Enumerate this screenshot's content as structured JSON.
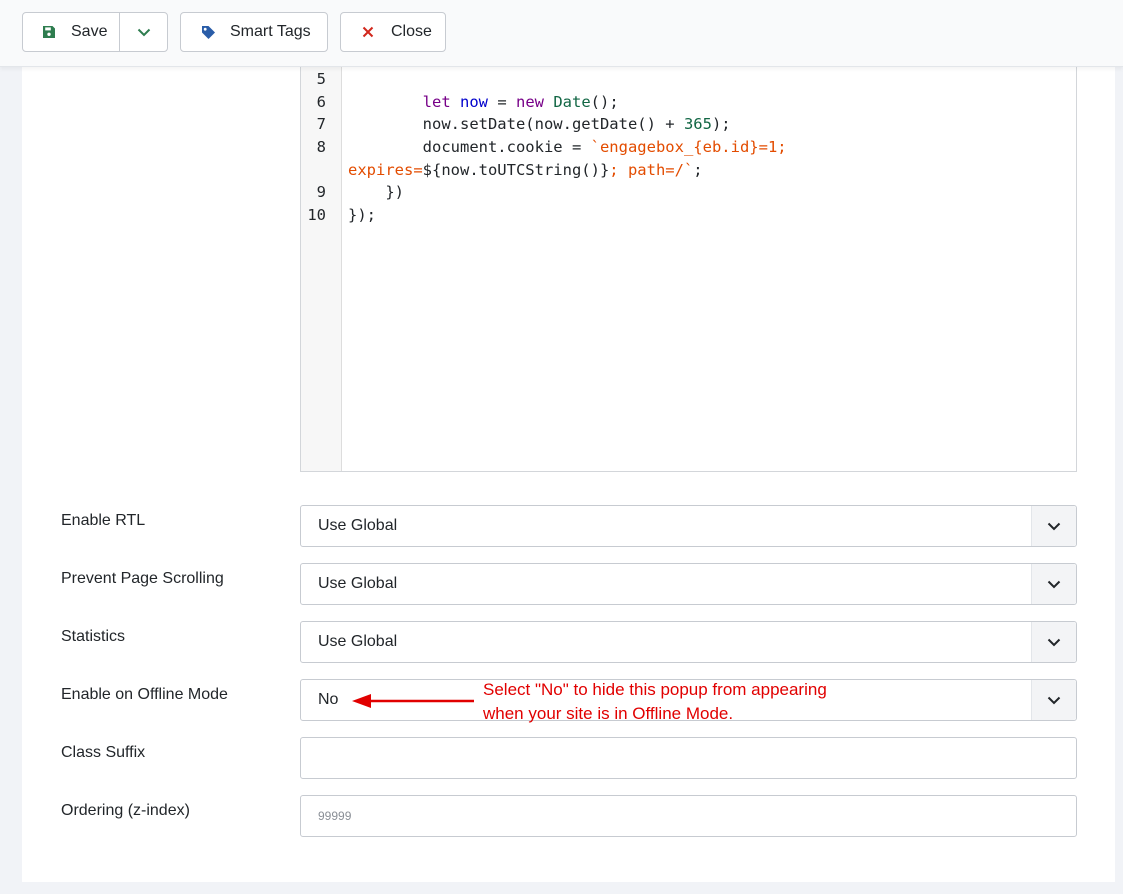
{
  "toolbar": {
    "save_label": "Save",
    "smart_tags_label": "Smart Tags",
    "close_label": "Close"
  },
  "editor": {
    "lines": [
      {
        "num": "5",
        "segments": []
      },
      {
        "num": "6",
        "segments": [
          {
            "t": "        ",
            "c": ""
          },
          {
            "t": "let",
            "c": "kw"
          },
          {
            "t": " ",
            "c": ""
          },
          {
            "t": "now",
            "c": "var"
          },
          {
            "t": " = ",
            "c": ""
          },
          {
            "t": "new",
            "c": "kw"
          },
          {
            "t": " ",
            "c": ""
          },
          {
            "t": "Date",
            "c": "def"
          },
          {
            "t": "();",
            "c": ""
          }
        ]
      },
      {
        "num": "7",
        "segments": [
          {
            "t": "        now.setDate(now.getDate() + ",
            "c": ""
          },
          {
            "t": "365",
            "c": "def"
          },
          {
            "t": ");",
            "c": ""
          }
        ]
      },
      {
        "num": "8",
        "segments": [
          {
            "t": "        document.cookie = ",
            "c": ""
          },
          {
            "t": "`engagebox_{eb.id}=1;",
            "c": "str"
          }
        ]
      },
      {
        "num": "",
        "segments": [
          {
            "t": "expires=",
            "c": "str"
          },
          {
            "t": "${now.toUTCString()}",
            "c": ""
          },
          {
            "t": "; path=/`",
            "c": "str"
          },
          {
            "t": ";",
            "c": ""
          }
        ]
      },
      {
        "num": "9",
        "segments": [
          {
            "t": "    })",
            "c": ""
          }
        ]
      },
      {
        "num": "10",
        "segments": [
          {
            "t": "});",
            "c": ""
          }
        ]
      }
    ]
  },
  "form": {
    "rtl": {
      "label": "Enable RTL",
      "value": "Use Global"
    },
    "scroll": {
      "label": "Prevent Page Scrolling",
      "value": "Use Global"
    },
    "stats": {
      "label": "Statistics",
      "value": "Use Global"
    },
    "offline": {
      "label": "Enable on Offline Mode",
      "value": "No"
    },
    "class_suffix": {
      "label": "Class Suffix",
      "value": ""
    },
    "ordering": {
      "label": "Ordering (z-index)",
      "placeholder": "99999"
    }
  },
  "annotation": {
    "line1": "Select \"No\" to hide this popup from appearing",
    "line2": "when your site is in Offline Mode."
  },
  "colors": {
    "annotation": "#e10000",
    "save_icon": "#2e7d4f",
    "tag_icon": "#2a5da8",
    "close_icon": "#d1271c"
  }
}
